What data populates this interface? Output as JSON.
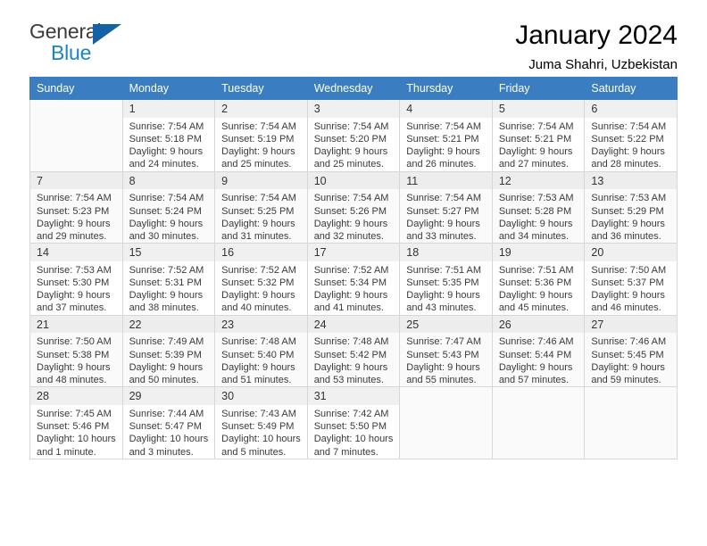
{
  "brand": {
    "name_top": "General",
    "name_bottom": "Blue",
    "triangle_color": "#1362a5",
    "blue_color": "#1b84c8"
  },
  "header": {
    "title": "January 2024",
    "subtitle": "Juma Shahri, Uzbekistan"
  },
  "theme": {
    "header_row_bg": "#3a7ec1",
    "header_row_text": "#ffffff",
    "grid_border": "#d7d7d7",
    "daynum_bg": "#f0f0f0",
    "alt_row_bg": "#fafafa"
  },
  "weekdays": [
    "Sunday",
    "Monday",
    "Tuesday",
    "Wednesday",
    "Thursday",
    "Friday",
    "Saturday"
  ],
  "weeks": [
    [
      {
        "day": "",
        "sunrise": "",
        "sunset": "",
        "daylight1": "",
        "daylight2": ""
      },
      {
        "day": "1",
        "sunrise": "Sunrise: 7:54 AM",
        "sunset": "Sunset: 5:18 PM",
        "daylight1": "Daylight: 9 hours",
        "daylight2": "and 24 minutes."
      },
      {
        "day": "2",
        "sunrise": "Sunrise: 7:54 AM",
        "sunset": "Sunset: 5:19 PM",
        "daylight1": "Daylight: 9 hours",
        "daylight2": "and 25 minutes."
      },
      {
        "day": "3",
        "sunrise": "Sunrise: 7:54 AM",
        "sunset": "Sunset: 5:20 PM",
        "daylight1": "Daylight: 9 hours",
        "daylight2": "and 25 minutes."
      },
      {
        "day": "4",
        "sunrise": "Sunrise: 7:54 AM",
        "sunset": "Sunset: 5:21 PM",
        "daylight1": "Daylight: 9 hours",
        "daylight2": "and 26 minutes."
      },
      {
        "day": "5",
        "sunrise": "Sunrise: 7:54 AM",
        "sunset": "Sunset: 5:21 PM",
        "daylight1": "Daylight: 9 hours",
        "daylight2": "and 27 minutes."
      },
      {
        "day": "6",
        "sunrise": "Sunrise: 7:54 AM",
        "sunset": "Sunset: 5:22 PM",
        "daylight1": "Daylight: 9 hours",
        "daylight2": "and 28 minutes."
      }
    ],
    [
      {
        "day": "7",
        "sunrise": "Sunrise: 7:54 AM",
        "sunset": "Sunset: 5:23 PM",
        "daylight1": "Daylight: 9 hours",
        "daylight2": "and 29 minutes."
      },
      {
        "day": "8",
        "sunrise": "Sunrise: 7:54 AM",
        "sunset": "Sunset: 5:24 PM",
        "daylight1": "Daylight: 9 hours",
        "daylight2": "and 30 minutes."
      },
      {
        "day": "9",
        "sunrise": "Sunrise: 7:54 AM",
        "sunset": "Sunset: 5:25 PM",
        "daylight1": "Daylight: 9 hours",
        "daylight2": "and 31 minutes."
      },
      {
        "day": "10",
        "sunrise": "Sunrise: 7:54 AM",
        "sunset": "Sunset: 5:26 PM",
        "daylight1": "Daylight: 9 hours",
        "daylight2": "and 32 minutes."
      },
      {
        "day": "11",
        "sunrise": "Sunrise: 7:54 AM",
        "sunset": "Sunset: 5:27 PM",
        "daylight1": "Daylight: 9 hours",
        "daylight2": "and 33 minutes."
      },
      {
        "day": "12",
        "sunrise": "Sunrise: 7:53 AM",
        "sunset": "Sunset: 5:28 PM",
        "daylight1": "Daylight: 9 hours",
        "daylight2": "and 34 minutes."
      },
      {
        "day": "13",
        "sunrise": "Sunrise: 7:53 AM",
        "sunset": "Sunset: 5:29 PM",
        "daylight1": "Daylight: 9 hours",
        "daylight2": "and 36 minutes."
      }
    ],
    [
      {
        "day": "14",
        "sunrise": "Sunrise: 7:53 AM",
        "sunset": "Sunset: 5:30 PM",
        "daylight1": "Daylight: 9 hours",
        "daylight2": "and 37 minutes."
      },
      {
        "day": "15",
        "sunrise": "Sunrise: 7:52 AM",
        "sunset": "Sunset: 5:31 PM",
        "daylight1": "Daylight: 9 hours",
        "daylight2": "and 38 minutes."
      },
      {
        "day": "16",
        "sunrise": "Sunrise: 7:52 AM",
        "sunset": "Sunset: 5:32 PM",
        "daylight1": "Daylight: 9 hours",
        "daylight2": "and 40 minutes."
      },
      {
        "day": "17",
        "sunrise": "Sunrise: 7:52 AM",
        "sunset": "Sunset: 5:34 PM",
        "daylight1": "Daylight: 9 hours",
        "daylight2": "and 41 minutes."
      },
      {
        "day": "18",
        "sunrise": "Sunrise: 7:51 AM",
        "sunset": "Sunset: 5:35 PM",
        "daylight1": "Daylight: 9 hours",
        "daylight2": "and 43 minutes."
      },
      {
        "day": "19",
        "sunrise": "Sunrise: 7:51 AM",
        "sunset": "Sunset: 5:36 PM",
        "daylight1": "Daylight: 9 hours",
        "daylight2": "and 45 minutes."
      },
      {
        "day": "20",
        "sunrise": "Sunrise: 7:50 AM",
        "sunset": "Sunset: 5:37 PM",
        "daylight1": "Daylight: 9 hours",
        "daylight2": "and 46 minutes."
      }
    ],
    [
      {
        "day": "21",
        "sunrise": "Sunrise: 7:50 AM",
        "sunset": "Sunset: 5:38 PM",
        "daylight1": "Daylight: 9 hours",
        "daylight2": "and 48 minutes."
      },
      {
        "day": "22",
        "sunrise": "Sunrise: 7:49 AM",
        "sunset": "Sunset: 5:39 PM",
        "daylight1": "Daylight: 9 hours",
        "daylight2": "and 50 minutes."
      },
      {
        "day": "23",
        "sunrise": "Sunrise: 7:48 AM",
        "sunset": "Sunset: 5:40 PM",
        "daylight1": "Daylight: 9 hours",
        "daylight2": "and 51 minutes."
      },
      {
        "day": "24",
        "sunrise": "Sunrise: 7:48 AM",
        "sunset": "Sunset: 5:42 PM",
        "daylight1": "Daylight: 9 hours",
        "daylight2": "and 53 minutes."
      },
      {
        "day": "25",
        "sunrise": "Sunrise: 7:47 AM",
        "sunset": "Sunset: 5:43 PM",
        "daylight1": "Daylight: 9 hours",
        "daylight2": "and 55 minutes."
      },
      {
        "day": "26",
        "sunrise": "Sunrise: 7:46 AM",
        "sunset": "Sunset: 5:44 PM",
        "daylight1": "Daylight: 9 hours",
        "daylight2": "and 57 minutes."
      },
      {
        "day": "27",
        "sunrise": "Sunrise: 7:46 AM",
        "sunset": "Sunset: 5:45 PM",
        "daylight1": "Daylight: 9 hours",
        "daylight2": "and 59 minutes."
      }
    ],
    [
      {
        "day": "28",
        "sunrise": "Sunrise: 7:45 AM",
        "sunset": "Sunset: 5:46 PM",
        "daylight1": "Daylight: 10 hours",
        "daylight2": "and 1 minute."
      },
      {
        "day": "29",
        "sunrise": "Sunrise: 7:44 AM",
        "sunset": "Sunset: 5:47 PM",
        "daylight1": "Daylight: 10 hours",
        "daylight2": "and 3 minutes."
      },
      {
        "day": "30",
        "sunrise": "Sunrise: 7:43 AM",
        "sunset": "Sunset: 5:49 PM",
        "daylight1": "Daylight: 10 hours",
        "daylight2": "and 5 minutes."
      },
      {
        "day": "31",
        "sunrise": "Sunrise: 7:42 AM",
        "sunset": "Sunset: 5:50 PM",
        "daylight1": "Daylight: 10 hours",
        "daylight2": "and 7 minutes."
      },
      {
        "day": "",
        "sunrise": "",
        "sunset": "",
        "daylight1": "",
        "daylight2": ""
      },
      {
        "day": "",
        "sunrise": "",
        "sunset": "",
        "daylight1": "",
        "daylight2": ""
      },
      {
        "day": "",
        "sunrise": "",
        "sunset": "",
        "daylight1": "",
        "daylight2": ""
      }
    ]
  ]
}
